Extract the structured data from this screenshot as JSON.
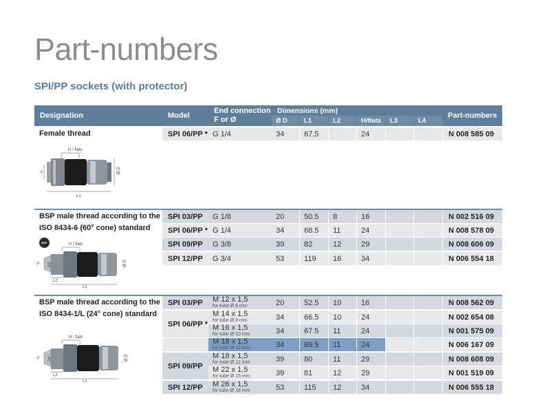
{
  "title": "Part-numbers",
  "subtitle": "SPI/PP sockets (with protector)",
  "headers": {
    "designation": "Designation",
    "model": "Model",
    "end_connection_1": "End connection",
    "end_connection_2": "F or Ø",
    "dimensions": "Dimensions (mm)",
    "dim_cols": [
      "Ø D",
      "L1",
      "L2",
      "H/flats",
      "L3",
      "L4"
    ],
    "part_numbers": "Part-numbers"
  },
  "groups": [
    {
      "title_1": "Female thread",
      "title_2": ""
    },
    {
      "title_1": "BSP male thread according to the",
      "title_2": "ISO 8434-6 (60° cone) standard"
    },
    {
      "title_1": "BSP male thread according to the",
      "title_2": "ISO 8434-1/L (24° cone) standard"
    }
  ],
  "rows": [
    {
      "model": "SPI 06/PP *",
      "conn": "G 1/4",
      "conn_sub": "",
      "d": "34",
      "l1": "67,5",
      "l2": "",
      "hf": "24",
      "l3": "",
      "l4": "",
      "pn": "N 008 585 09"
    },
    {
      "model": "SPI 03/PP",
      "conn": "G 1/8",
      "conn_sub": "",
      "d": "20",
      "l1": "50.5",
      "l2": "8",
      "hf": "16",
      "l3": "",
      "l4": "",
      "pn": "N 002 516 09"
    },
    {
      "model": "SPI 06/PP *",
      "conn": "G 1/4",
      "conn_sub": "",
      "d": "34",
      "l1": "68.5",
      "l2": "11",
      "hf": "24",
      "l3": "",
      "l4": "",
      "pn": "N 008 578 09"
    },
    {
      "model": "SPI 09/PP",
      "conn": "G 3/8",
      "conn_sub": "",
      "d": "39",
      "l1": "82",
      "l2": "12",
      "hf": "29",
      "l3": "",
      "l4": "",
      "pn": "N 008 606 09"
    },
    {
      "model": "SPI 12/PP",
      "conn": "G 3/4",
      "conn_sub": "",
      "d": "53",
      "l1": "119",
      "l2": "16",
      "hf": "34",
      "l3": "",
      "l4": "",
      "pn": "N 006 554 18"
    },
    {
      "model": "SPI 03/PP",
      "conn": "M 12 x 1,5",
      "conn_sub": "for tube Ø 6 mm",
      "d": "20",
      "l1": "52.5",
      "l2": "10",
      "hf": "16",
      "l3": "",
      "l4": "",
      "pn": "N 008 562 09"
    },
    {
      "model": "SPI 06/PP *",
      "conn": "M 14 x 1,5",
      "conn_sub": "for tube Ø 8 mm",
      "d": "34",
      "l1": "66.5",
      "l2": "10",
      "hf": "24",
      "l3": "",
      "l4": "",
      "pn": "N 002 654 08"
    },
    {
      "model": "",
      "conn": "M 16 x 1,5",
      "conn_sub": "for tube Ø 10 mm",
      "d": "34",
      "l1": "67.5",
      "l2": "11",
      "hf": "24",
      "l3": "",
      "l4": "",
      "pn": "N 001 575 09"
    },
    {
      "model": "",
      "conn": "M 18 x 1,5",
      "conn_sub": "for tube Ø 12 mm",
      "d": "34",
      "l1": "69.5",
      "l2": "11",
      "hf": "24",
      "l3": "",
      "l4": "",
      "pn": "N 006 167 09"
    },
    {
      "model": "SPI 09/PP",
      "conn": "M 18 x 1,5",
      "conn_sub": "for tube Ø 12 mm",
      "d": "39",
      "l1": "80",
      "l2": "11",
      "hf": "29",
      "l3": "",
      "l4": "",
      "pn": "N 008 608 09"
    },
    {
      "model": "",
      "conn": "M 22 x 1,5",
      "conn_sub": "for tube Ø 15 mm",
      "d": "39",
      "l1": "81",
      "l2": "12",
      "hf": "29",
      "l3": "",
      "l4": "",
      "pn": "N 001 519 09"
    },
    {
      "model": "SPI 12/PP",
      "conn": "M 26 x 1,5",
      "conn_sub": "for tube Ø 18 mm",
      "d": "53",
      "l1": "115",
      "l2": "12",
      "hf": "34",
      "l3": "",
      "l4": "",
      "pn": "N 006 555 18"
    }
  ],
  "drawing_labels": {
    "hflats": "H / flats",
    "f": "F",
    "od": "Ø D",
    "l1": "L1",
    "l2": "L2",
    "angle60": "60°",
    "angle24": "24°",
    "badge": "BSP"
  },
  "colors": {
    "header": "#5f7e9b",
    "row_light": "#e6e8ea",
    "row_mid": "#d3d8de",
    "highlight": "#7b9fc4",
    "title_grey": "#8c8c8c",
    "subtitle_blue": "#5a7a9c"
  }
}
